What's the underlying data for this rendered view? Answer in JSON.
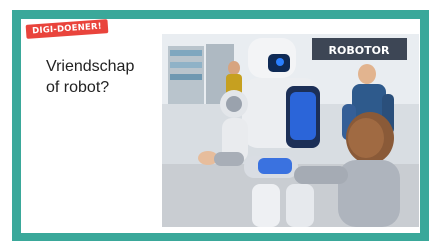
{
  "badge": {
    "label": "DIGI-DOENER!"
  },
  "card": {
    "title_line1": "Vriendschap",
    "title_line2": "of robot?"
  },
  "photo": {
    "sign_text": "ROBOTOR"
  },
  "colors": {
    "frame": "#3aa89a",
    "badge": "#e9443c",
    "card": "#ffffff"
  }
}
